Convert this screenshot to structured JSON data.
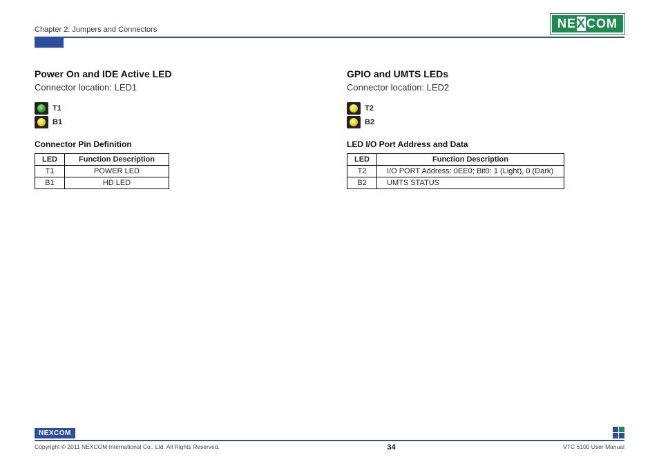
{
  "header": {
    "chapter": "Chapter 2: Jumpers and Connectors",
    "logo_ne": "NE",
    "logo_x": "X",
    "logo_com": "COM"
  },
  "left": {
    "title": "Power On and IDE Active LED",
    "connector": "Connector location: LED1",
    "leds": [
      {
        "label": "T1",
        "color": "green"
      },
      {
        "label": "B1",
        "color": "yellow"
      }
    ],
    "table_title": "Connector Pin Definition",
    "headers": {
      "led": "LED",
      "desc": "Function Description"
    },
    "rows": [
      {
        "led": "T1",
        "desc": "POWER LED"
      },
      {
        "led": "B1",
        "desc": "HD LED"
      }
    ]
  },
  "right": {
    "title": "GPIO and UMTS LEDs",
    "connector": "Connector location: LED2",
    "leds": [
      {
        "label": "T2",
        "color": "yellow"
      },
      {
        "label": "B2",
        "color": "yellow"
      }
    ],
    "table_title": "LED I/O Port Address and Data",
    "headers": {
      "led": "LED",
      "desc": "Function Description"
    },
    "rows": [
      {
        "led": "T2",
        "desc": "I/O PORT Address: 0EE0; Bit0: 1 (Light), 0 (Dark)"
      },
      {
        "led": "B2",
        "desc": "UMTS STATUS"
      }
    ]
  },
  "footer": {
    "logo": "NEXCOM",
    "copyright": "Copyright © 2011 NEXCOM International Co., Ltd. All Rights Reserved.",
    "page": "34",
    "manual": "VTC 6100 User Manual"
  }
}
